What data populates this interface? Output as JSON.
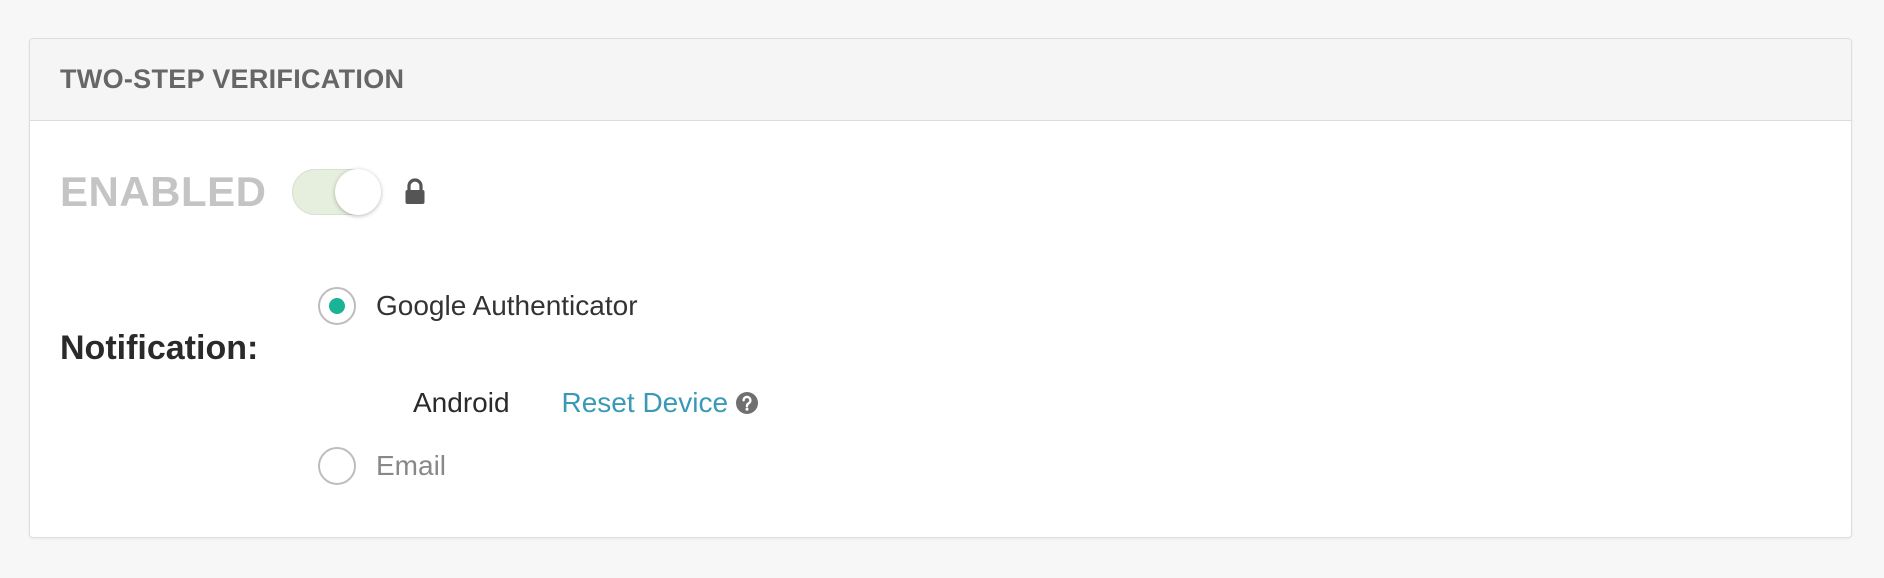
{
  "panel": {
    "title": "TWO-STEP VERIFICATION"
  },
  "status": {
    "label": "ENABLED",
    "toggle_on": true,
    "toggle_locked": true,
    "toggle_color": "#e6efde",
    "lock_icon": "lock-icon"
  },
  "notification": {
    "label": "Notification:",
    "options": [
      {
        "label": "Google Authenticator",
        "selected": true
      },
      {
        "label": "Email",
        "selected": false
      }
    ],
    "device": {
      "name": "Android",
      "reset_label": "Reset Device",
      "help_icon": "question-circle-icon"
    },
    "accent_color": "#1ab394",
    "link_color": "#3a9ab5"
  }
}
